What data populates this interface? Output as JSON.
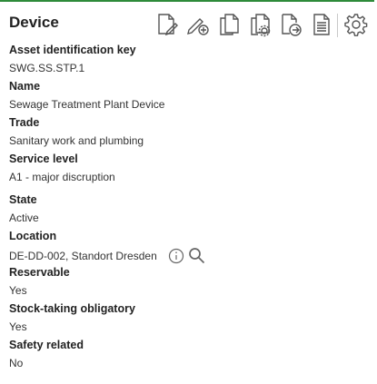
{
  "header": {
    "title": "Device",
    "toolbar_icons": [
      "edit-document-icon",
      "edit-add-icon",
      "copy-icon",
      "document-settings-icon",
      "document-export-icon",
      "document-lines-icon",
      "settings-gear-icon"
    ]
  },
  "fields": [
    {
      "label": "Asset identification key",
      "value": "SWG.SS.STP.1"
    },
    {
      "label": "Name",
      "value": "Sewage Treatment Plant Device"
    },
    {
      "label": "Trade",
      "value": "Sanitary work and plumbing"
    },
    {
      "label": "Service level",
      "value": "A1 - major discruption"
    },
    {
      "label": "State",
      "value": "Active"
    },
    {
      "label": "Location",
      "value": "DE-DD-002, Standort Dresden"
    },
    {
      "label": "Reservable",
      "value": "Yes"
    },
    {
      "label": "Stock-taking obligatory",
      "value": "Yes"
    },
    {
      "label": "Safety related",
      "value": "No"
    }
  ],
  "colors": {
    "accent": "#2e8b3a",
    "icon": "#555555"
  }
}
